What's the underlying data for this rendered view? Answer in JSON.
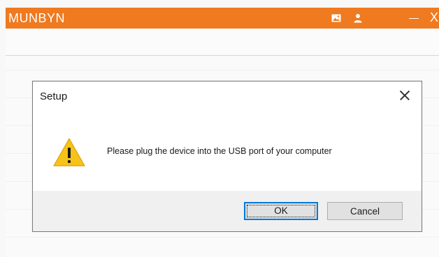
{
  "app": {
    "title": "MUNBYN",
    "window_close": "X",
    "accent_color": "#ef7a1f",
    "icons": [
      "image-icon",
      "user-icon",
      "minimize-icon"
    ]
  },
  "dialog": {
    "title": "Setup",
    "message": "Please plug the device into the USB port of your computer",
    "icon": "warning-icon",
    "ok_label": "OK",
    "cancel_label": "Cancel",
    "focus_color": "#0078d7"
  }
}
